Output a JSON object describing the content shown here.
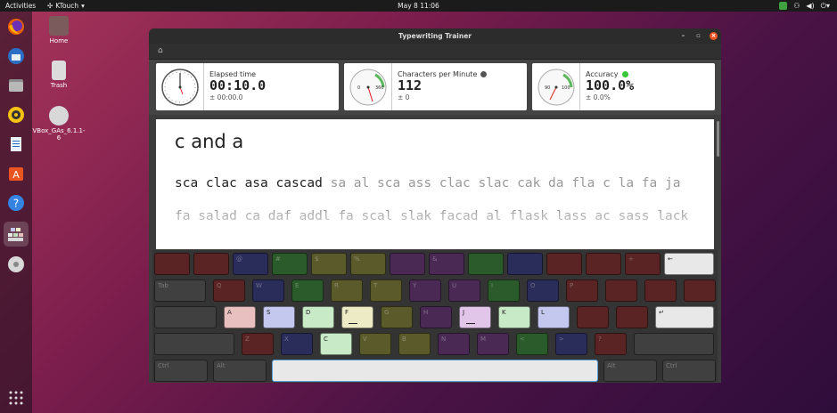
{
  "topbar": {
    "activities": "Activities",
    "app_name": "KTouch",
    "clock": "May 8  11:06"
  },
  "desktop": {
    "home": "Home",
    "trash": "Trash",
    "vbox": "VBox_GAs_6.1.1-6"
  },
  "window": {
    "title": "Typewriting Trainer"
  },
  "stats": {
    "elapsed": {
      "label": "Elapsed time",
      "value": "00:10.0",
      "sub": "± 00:00.0"
    },
    "cpm": {
      "label": "Characters per Minute",
      "value": "112",
      "sub": "± 0",
      "dial_left": "0",
      "dial_right": "360",
      "indicator": "#555555"
    },
    "accuracy": {
      "label": "Accuracy",
      "value": "100.0%",
      "sub": "± 0.0%",
      "dial_left": "90",
      "dial_right": "100",
      "indicator": "#38c738"
    }
  },
  "lesson": {
    "title": "c and a",
    "line1_typed": "sca clac asa cascad",
    "line1_rest": " sa al sca ass clac slac cak da fla c la fa ja",
    "line2": "fa salad ca daf addl fa scal slak facad al flask lass ac sass lack"
  },
  "keyboard": {
    "rows": [
      {
        "keys": [
          {
            "label": "",
            "color": "#5a2424"
          },
          {
            "label": "",
            "color": "#5a2424"
          },
          {
            "label": "@",
            "color": "#2a2d5a"
          },
          {
            "label": "#",
            "color": "#2b5a2b"
          },
          {
            "label": "$",
            "color": "#5a5a2a"
          },
          {
            "label": "%",
            "color": "#5a5a2a"
          },
          {
            "label": "",
            "color": "#4a2a55"
          },
          {
            "label": "&",
            "color": "#4a2a55"
          },
          {
            "label": "",
            "color": "#2b5a2b"
          },
          {
            "label": "",
            "color": "#2a2d5a"
          },
          {
            "label": "",
            "color": "#5a2424"
          },
          {
            "label": "",
            "color": "#5a2424"
          },
          {
            "label": "+",
            "color": "#5a2424"
          },
          {
            "label": "←",
            "color": "#e8e8e8",
            "lit": true
          }
        ]
      },
      {
        "keys": [
          {
            "label": "Tab",
            "color": "#404040"
          },
          {
            "label": "Q",
            "color": "#5a2424"
          },
          {
            "label": "W",
            "color": "#2a2d5a"
          },
          {
            "label": "E",
            "color": "#2b5a2b"
          },
          {
            "label": "R",
            "color": "#5a5a2a"
          },
          {
            "label": "T",
            "color": "#5a5a2a"
          },
          {
            "label": "Y",
            "color": "#4a2a55"
          },
          {
            "label": "U",
            "color": "#4a2a55"
          },
          {
            "label": "I",
            "color": "#2b5a2b"
          },
          {
            "label": "O",
            "color": "#2a2d5a"
          },
          {
            "label": "P",
            "color": "#5a2424"
          },
          {
            "label": "",
            "color": "#5a2424"
          },
          {
            "label": "",
            "color": "#5a2424"
          },
          {
            "label": "",
            "color": "#5a2424"
          }
        ]
      },
      {
        "keys": [
          {
            "label": "",
            "color": "#404040"
          },
          {
            "label": "A",
            "color": "#e8c0c0",
            "lit": true
          },
          {
            "label": "S",
            "color": "#c4c7ee",
            "lit": true
          },
          {
            "label": "D",
            "color": "#c9eac6",
            "lit": true
          },
          {
            "label": "F",
            "color": "#ecebc5",
            "lit": true,
            "bump": true
          },
          {
            "label": "G",
            "color": "#5a5a2a"
          },
          {
            "label": "H",
            "color": "#4a2a55"
          },
          {
            "label": "J",
            "color": "#e2c6ea",
            "lit": true,
            "bump": true
          },
          {
            "label": "K",
            "color": "#c9eac6",
            "lit": true
          },
          {
            "label": "L",
            "color": "#c4c7ee",
            "lit": true
          },
          {
            "label": "",
            "color": "#5a2424"
          },
          {
            "label": "",
            "color": "#5a2424"
          },
          {
            "label": "↵",
            "color": "#e8e8e8",
            "lit": true
          }
        ]
      },
      {
        "keys": [
          {
            "label": "",
            "color": "#404040"
          },
          {
            "label": "Z",
            "color": "#5a2424"
          },
          {
            "label": "X",
            "color": "#2a2d5a"
          },
          {
            "label": "C",
            "color": "#c9eac6",
            "lit": true
          },
          {
            "label": "V",
            "color": "#5a5a2a"
          },
          {
            "label": "B",
            "color": "#5a5a2a"
          },
          {
            "label": "N",
            "color": "#4a2a55"
          },
          {
            "label": "M",
            "color": "#4a2a55"
          },
          {
            "label": "<",
            "color": "#2b5a2b"
          },
          {
            "label": ">",
            "color": "#2a2d5a"
          },
          {
            "label": "?",
            "color": "#5a2424"
          },
          {
            "label": "",
            "color": "#404040"
          }
        ]
      },
      {
        "keys": [
          {
            "label": "Ctrl",
            "color": "#404040"
          },
          {
            "label": "Alt",
            "color": "#404040"
          },
          {
            "label": "",
            "color": "#e8e8e8",
            "lit": true
          },
          {
            "label": "Alt",
            "color": "#404040"
          },
          {
            "label": "Ctrl",
            "color": "#404040"
          }
        ]
      }
    ]
  }
}
